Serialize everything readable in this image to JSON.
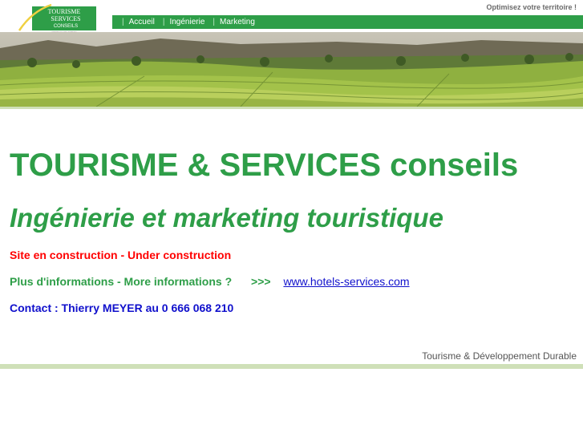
{
  "header": {
    "slogan": "Optimisez votre territoire !",
    "logo": {
      "line1": "TOURISME",
      "line2": "SERVICES",
      "line3": "CONSEILS",
      "tagline": "optimisez votre territoire"
    },
    "nav": [
      {
        "label": "Accueil"
      },
      {
        "label": "Ingénierie"
      },
      {
        "label": "Marketing"
      }
    ],
    "separator": "|"
  },
  "main": {
    "title": "TOURISME & SERVICES conseils",
    "subtitle": "Ingénierie et marketing touristique",
    "construction": "Site en construction - Under construction",
    "more_info": "Plus d'informations  -  More informations ?",
    "arrows": ">>>",
    "link": "www.hotels-services.com",
    "contact": "Contact : Thierry MEYER au 0 666 068 210"
  },
  "footer": {
    "text": "Tourisme & Développement Durable"
  },
  "colors": {
    "brand_green": "#2e9e48",
    "alert_red": "#ff0000",
    "link_blue": "#1010cc",
    "pale_green": "#cfe0b8"
  }
}
